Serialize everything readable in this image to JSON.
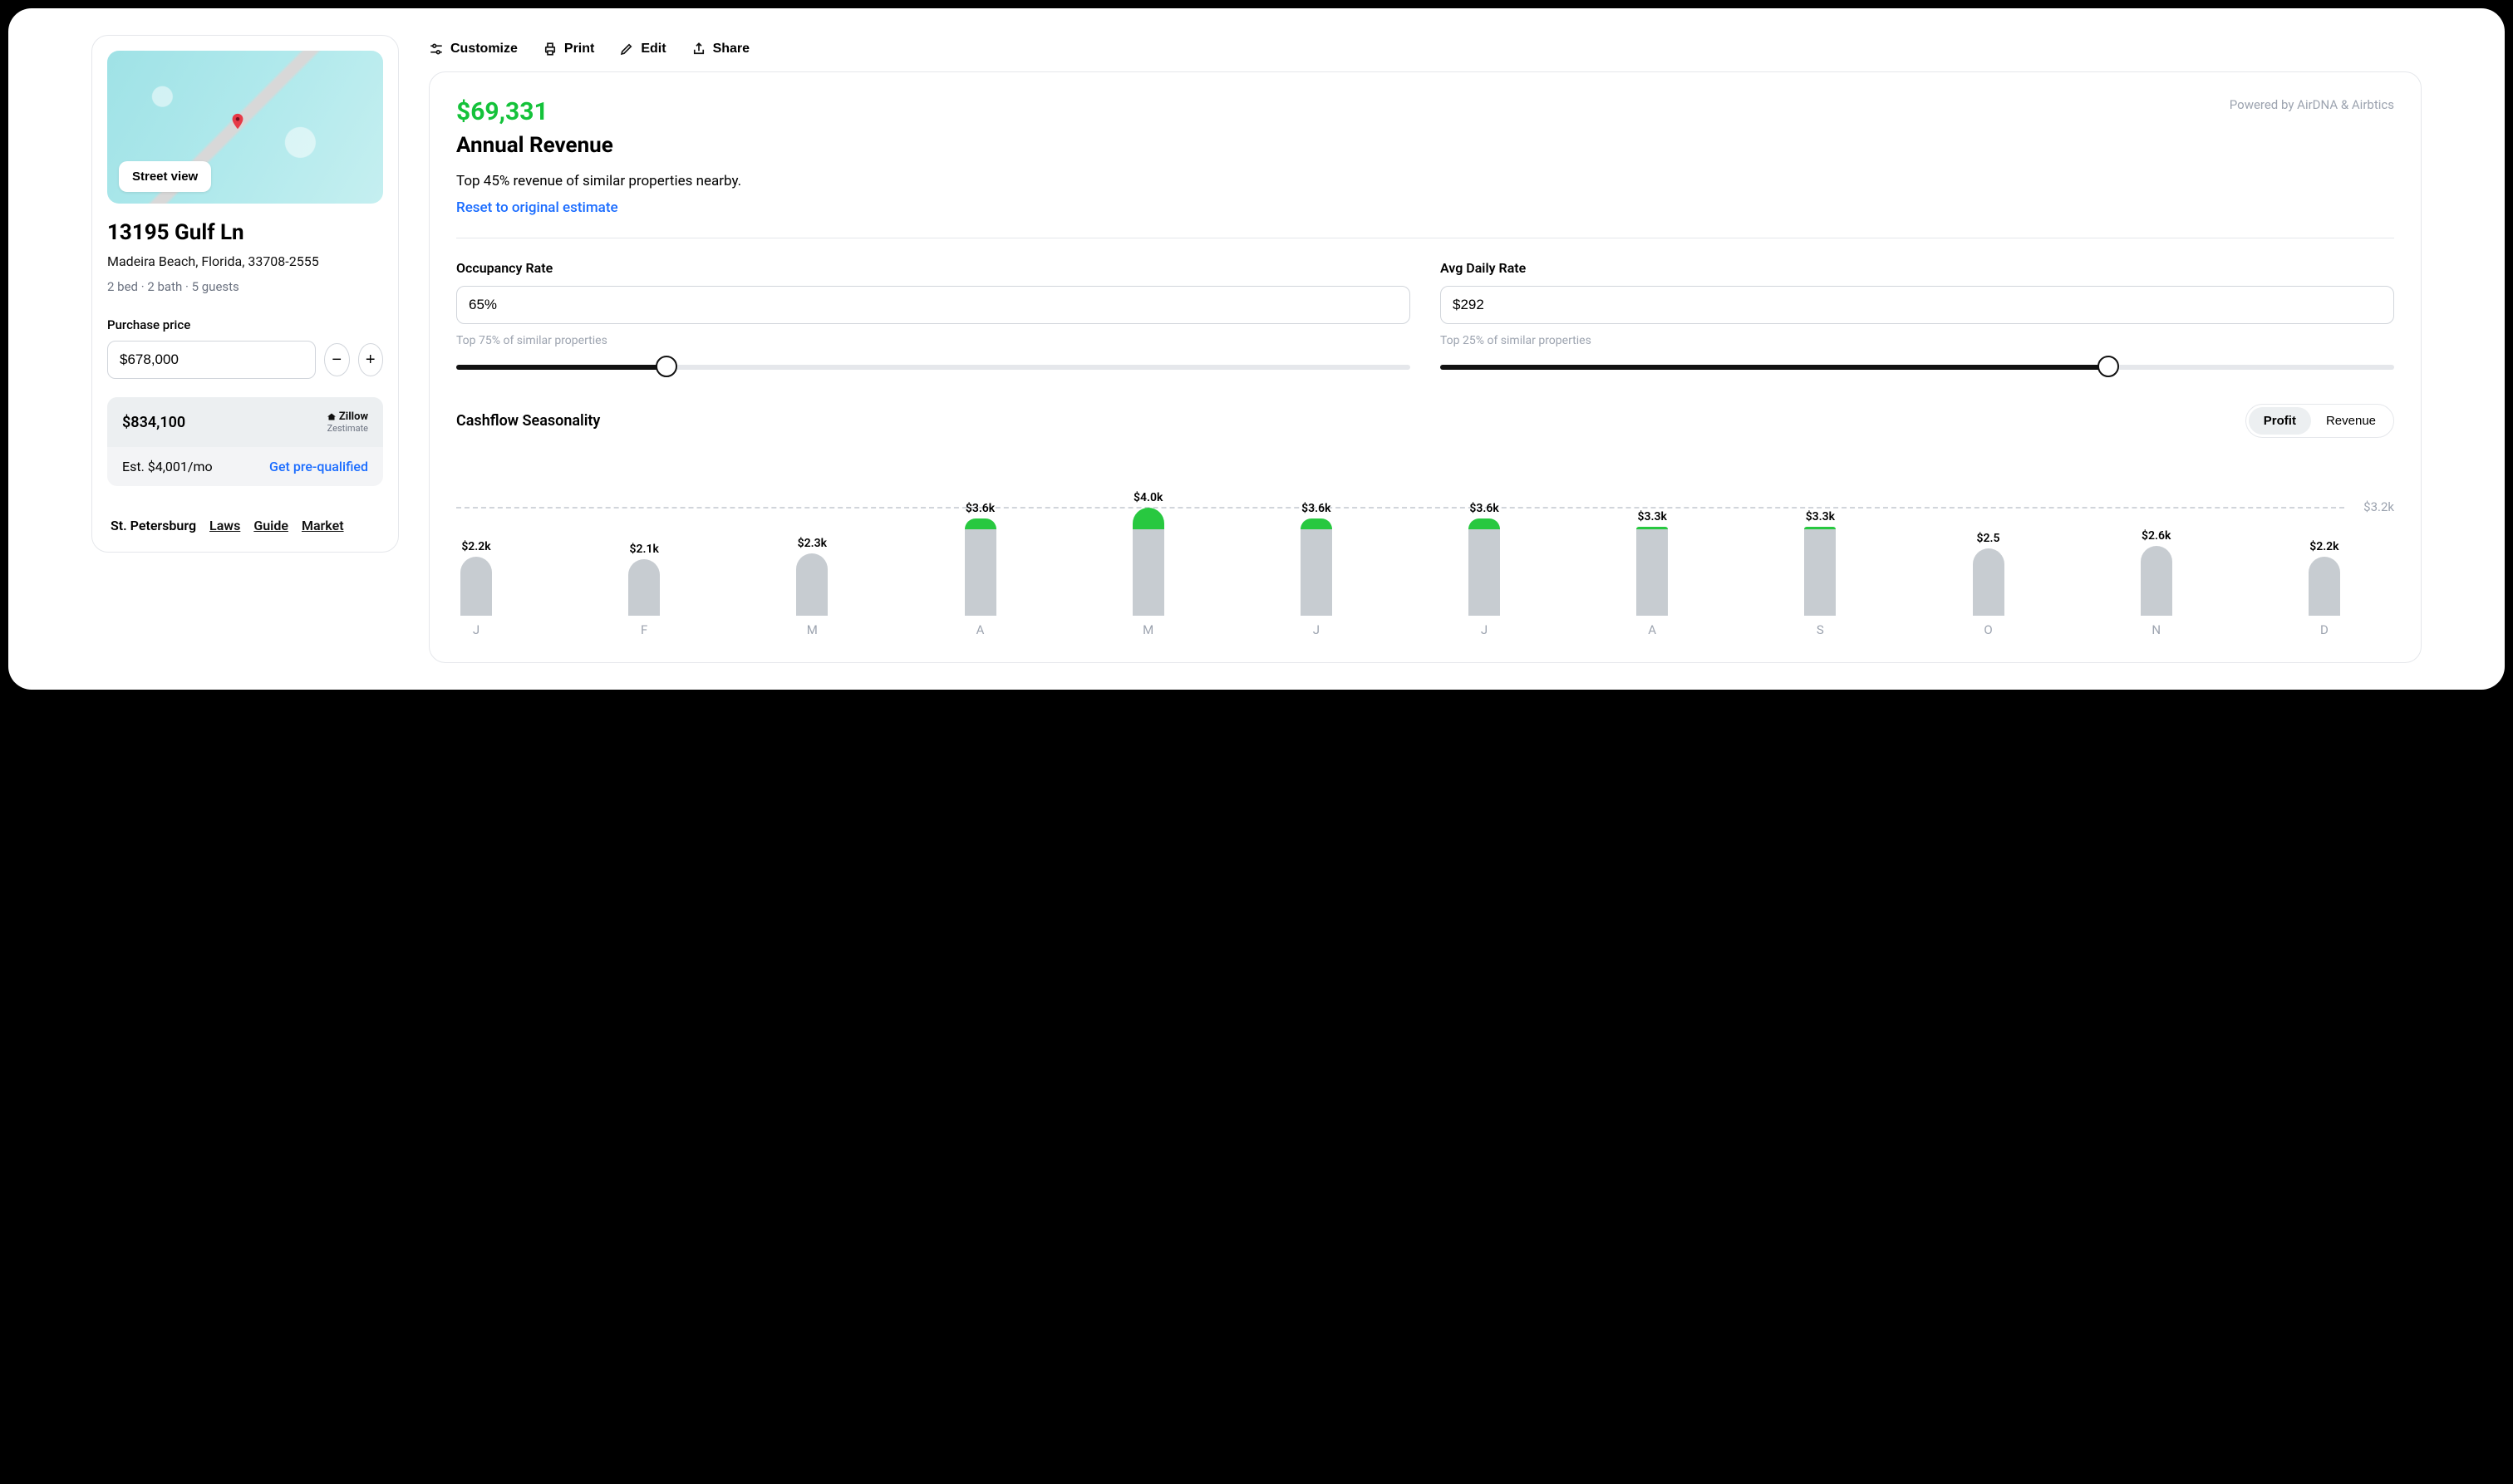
{
  "property": {
    "street_view_label": "Street view",
    "address_line1": "13195 Gulf Ln",
    "address_line2": "Madeira Beach, Florida, 33708-2555",
    "details": "2 bed · 2 bath · 5 guests",
    "purchase_price_label": "Purchase price",
    "purchase_price": "$678,000",
    "zestimate_value": "$834,100",
    "zillow_brand": "Zillow",
    "zestimate_label": "Zestimate",
    "est_monthly": "Est. $4,001/mo",
    "prequal_label": "Get pre-qualified",
    "city": "St. Petersburg",
    "link_laws": "Laws",
    "link_guide": "Guide",
    "link_market": "Market"
  },
  "toolbar": {
    "customize": "Customize",
    "print": "Print",
    "edit": "Edit",
    "share": "Share"
  },
  "revenue": {
    "value": "$69,331",
    "title": "Annual Revenue",
    "powered_by": "Powered by AirDNA & Airbtics",
    "subtitle": "Top 45% revenue of similar properties nearby.",
    "reset_label": "Reset to original estimate"
  },
  "inputs": {
    "occupancy": {
      "label": "Occupancy Rate",
      "value": "65%",
      "hint": "Top 75% of similar properties",
      "slider_pct": 22
    },
    "adr": {
      "label": "Avg Daily Rate",
      "value": "$292",
      "hint": "Top 25% of similar properties",
      "slider_pct": 70
    }
  },
  "chart": {
    "title": "Cashflow Seasonality",
    "toggle_profit": "Profit",
    "toggle_revenue": "Revenue",
    "avg_label": "$3.2k"
  },
  "chart_data": {
    "type": "bar",
    "title": "Cashflow Seasonality",
    "ylabel": "Profit",
    "categories": [
      "J",
      "F",
      "M",
      "A",
      "M",
      "J",
      "J",
      "A",
      "S",
      "O",
      "N",
      "D"
    ],
    "series": [
      {
        "name": "Profit ($k)",
        "values": [
          2.2,
          2.1,
          2.3,
          3.6,
          4.0,
          3.6,
          3.6,
          3.3,
          3.3,
          2.5,
          2.6,
          2.2
        ]
      }
    ],
    "average": 3.2,
    "value_labels": [
      "$2.2k",
      "$2.1k",
      "$2.3k",
      "$3.6k",
      "$4.0k",
      "$3.6k",
      "$3.6k",
      "$3.3k",
      "$3.3k",
      "$2.5",
      "$2.6k",
      "$2.2k"
    ],
    "ylim": [
      0,
      4.0
    ]
  }
}
